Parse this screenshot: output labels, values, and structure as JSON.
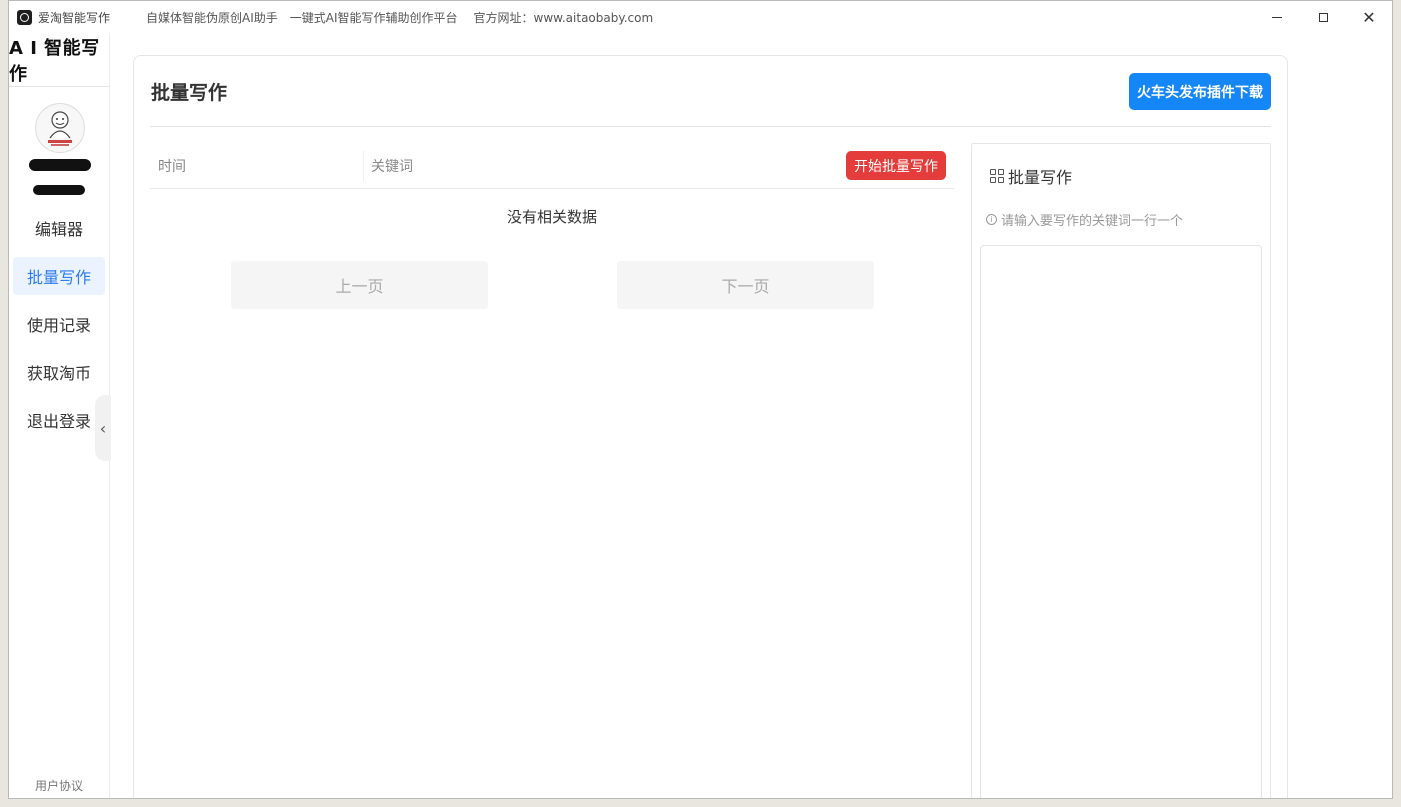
{
  "window": {
    "app_name": "爱淘智能写作",
    "subtitle1": "自媒体智能伪原创AI助手",
    "subtitle2": "一键式AI智能写作辅助创作平台",
    "website": "官方网址：www.aitaobaby.com"
  },
  "sidebar": {
    "logo": "A I 智能写作",
    "items": [
      {
        "label": "编辑器"
      },
      {
        "label": "批量写作"
      },
      {
        "label": "使用记录"
      },
      {
        "label": "获取淘币"
      },
      {
        "label": "退出登录"
      }
    ],
    "active_index": 1,
    "agreement": "用户协议",
    "collapse_icon": "chevron-left-icon"
  },
  "main": {
    "title": "批量写作",
    "download_button": "火车头发布插件下载",
    "table": {
      "columns": [
        "时间",
        "关键词"
      ],
      "start_button": "开始批量写作",
      "empty_text": "没有相关数据"
    },
    "pager": {
      "prev": "上一页",
      "next": "下一页"
    }
  },
  "panel": {
    "title": "批量写作",
    "hint": "请输入要写作的关键词一行一个",
    "textarea_value": ""
  },
  "colors": {
    "accent_blue": "#1586f6",
    "start_red": "#e43b3b",
    "active_nav_bg": "#eaf3ff",
    "active_nav_text": "#2d7cf0"
  }
}
